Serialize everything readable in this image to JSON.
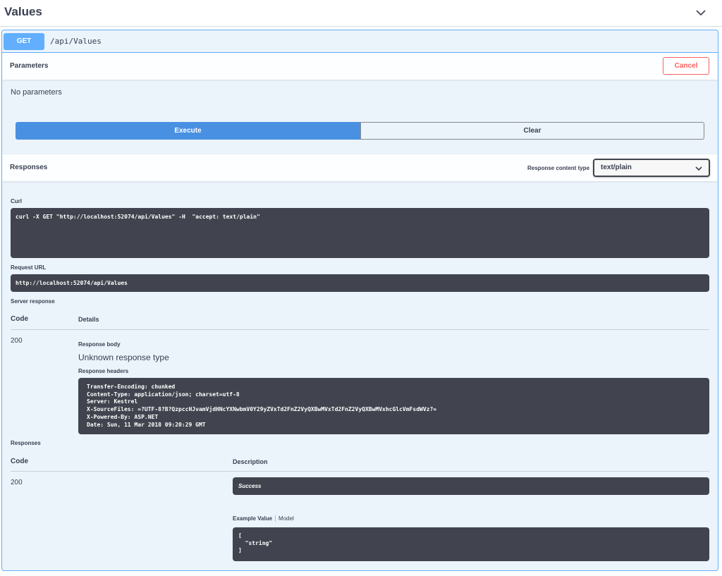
{
  "tag": {
    "title": "Values"
  },
  "operation": {
    "method": "GET",
    "path": "/api/Values"
  },
  "parameters": {
    "heading": "Parameters",
    "cancel_label": "Cancel",
    "empty_text": "No parameters"
  },
  "actions": {
    "execute_label": "Execute",
    "clear_label": "Clear"
  },
  "responses_section": {
    "heading": "Responses",
    "content_type_label": "Response content type",
    "content_type_value": "text/plain"
  },
  "curl": {
    "label": "Curl",
    "command": "curl -X GET \"http://localhost:52074/api/Values\" -H  \"accept: text/plain\""
  },
  "request_url": {
    "label": "Request URL",
    "value": "http://localhost:52074/api/Values"
  },
  "server_response": {
    "label": "Server response",
    "code_header": "Code",
    "details_header": "Details",
    "code": "200",
    "body_label": "Response body",
    "body_text": "Unknown response type",
    "headers_label": "Response headers",
    "headers": "Transfer-Encoding: chunked\nContent-Type: application/json; charset=utf-8\nServer: Kestrel\nX-SourceFiles: =?UTF-8?B?QzpccHJvamVjdHNcYXNwbmV0Y29yZVxTd2FnZ2VyQXBwMVxTd2FnZ2VyQXBwMVxhcGlcVmFsdWVz?=\nX-Powered-By: ASP.NET\nDate: Sun, 11 Mar 2018 09:20:29 GMT"
  },
  "documented_responses": {
    "label": "Responses",
    "code_header": "Code",
    "description_header": "Description",
    "code": "200",
    "description": "Success",
    "example_value_tab": "Example Value",
    "model_tab": "Model",
    "example": "[\n  \"string\"\n]"
  }
}
